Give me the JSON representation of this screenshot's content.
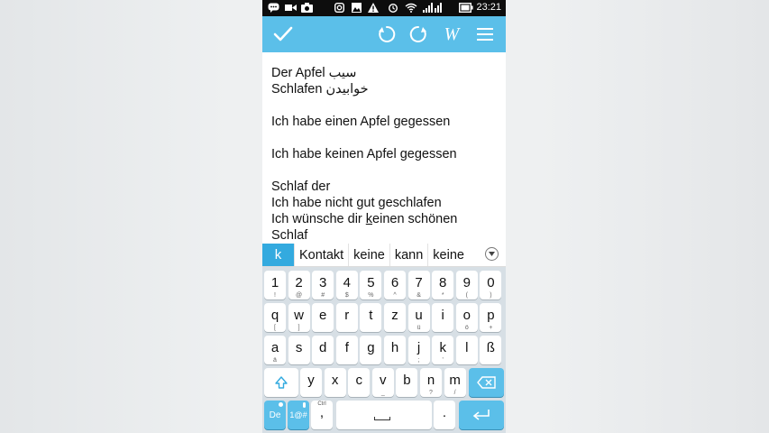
{
  "status_bar": {
    "time": "23:21",
    "icons": [
      "chat-icon",
      "video-icon",
      "camera-icon",
      "instagram-icon",
      "image-icon",
      "warning-icon",
      "alarm-icon",
      "wifi-icon",
      "signal-icon",
      "battery-icon"
    ]
  },
  "toolbar": {
    "buttons": [
      "check-icon",
      "undo-icon",
      "redo-icon",
      "wiki-icon",
      "menu-icon"
    ],
    "wiki_label": "W"
  },
  "editor": {
    "lines": [
      "Der Apfel سیب",
      "Schlafen خوابیدن",
      "",
      "Ich habe einen Apfel gegessen",
      "",
      "Ich habe keinen Apfel gegessen",
      "",
      "Schlaf der",
      "Ich habe nicht gut geschlafen",
      "Ich wünsche dir keinen schönen",
      "Schlaf"
    ],
    "underlined_letter": "k"
  },
  "suggestions": {
    "active": "k",
    "items": [
      "Kontakt",
      "keine",
      "kann",
      "keine"
    ]
  },
  "keyboard": {
    "row1": [
      [
        "1",
        "!"
      ],
      [
        "2",
        "@"
      ],
      [
        "3",
        "#"
      ],
      [
        "4",
        "$"
      ],
      [
        "5",
        "%"
      ],
      [
        "6",
        "^"
      ],
      [
        "7",
        "&"
      ],
      [
        "8",
        "*"
      ],
      [
        "9",
        "("
      ],
      [
        "0",
        ")"
      ]
    ],
    "row2": [
      [
        "q",
        "["
      ],
      [
        "w",
        "]"
      ],
      [
        "e",
        ""
      ],
      [
        "r",
        ""
      ],
      [
        "t",
        ""
      ],
      [
        "z",
        ""
      ],
      [
        "u",
        "ü"
      ],
      [
        "i",
        ""
      ],
      [
        "o",
        "ö"
      ],
      [
        "p",
        "+"
      ]
    ],
    "row3": [
      [
        "a",
        "ä"
      ],
      [
        "s",
        ""
      ],
      [
        "d",
        ""
      ],
      [
        "f",
        ""
      ],
      [
        "g",
        ""
      ],
      [
        "h",
        ""
      ],
      [
        "j",
        ";"
      ],
      [
        "k",
        "'"
      ],
      [
        "l",
        ""
      ],
      [
        "ß",
        ""
      ]
    ],
    "row4": [
      [
        "y",
        ""
      ],
      [
        "x",
        ""
      ],
      [
        "c",
        ""
      ],
      [
        "v",
        "_"
      ],
      [
        "b",
        ""
      ],
      [
        "n",
        "?"
      ],
      [
        "m",
        "/"
      ]
    ],
    "lang_label": "De",
    "symbols_label": "1@#",
    "comma_label": ",",
    "ctrl_label": "Ctrl",
    "period_label": "."
  },
  "colors": {
    "toolbar": "#5bbfe9",
    "suggestion_active": "#33aadf",
    "keyboard_bg": "#d7dfe5",
    "status_bar": "#0d0d0d"
  }
}
